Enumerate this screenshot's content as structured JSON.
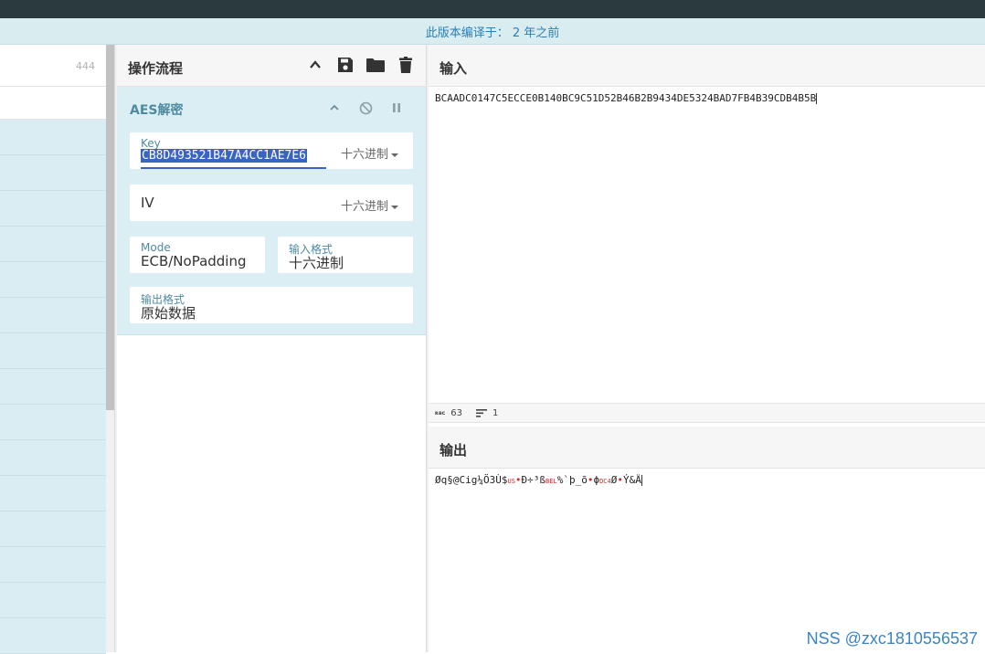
{
  "banner": {
    "text": "此版本编译于：  2 年之前"
  },
  "operations": {
    "count": "444"
  },
  "recipe": {
    "title": "操作流程",
    "icons": [
      "chevron-up-icon",
      "save-icon",
      "folder-icon",
      "trash-icon"
    ],
    "operation": {
      "name": "AES解密",
      "key": {
        "label": "Key",
        "value": "CB8D493521B47A4CC1AE7E6",
        "format": "十六进制"
      },
      "iv": {
        "label": "IV",
        "value": "",
        "format": "十六进制"
      },
      "mode": {
        "label": "Mode",
        "value": "ECB/NoPadding"
      },
      "input_format": {
        "label": "输入格式",
        "value": "十六进制"
      },
      "output_format": {
        "label": "输出格式",
        "value": "原始数据"
      }
    }
  },
  "input": {
    "title": "输入",
    "value": "BCAADC0147C5ECCE0B140BC9C51D52B46B2B9434DE5324BAD7FB4B39CDB4B5B",
    "length_label": "ʀʙᴄ",
    "length": "63",
    "lines": "1"
  },
  "output": {
    "title": "输出",
    "parts": [
      {
        "t": "Øq§@Cig¼Ö3Ù$",
        "c": "normal"
      },
      {
        "t": "US",
        "c": "ctrl"
      },
      {
        "t": "•",
        "c": "red"
      },
      {
        "t": "Ð÷³ß",
        "c": "normal"
      },
      {
        "t": "BEL",
        "c": "ctrl"
      },
      {
        "t": "%`þ_õ",
        "c": "normal"
      },
      {
        "t": "•",
        "c": "red"
      },
      {
        "t": "ϕ",
        "c": "normal"
      },
      {
        "t": "DC4",
        "c": "ctrl"
      },
      {
        "t": "Ø",
        "c": "normal"
      },
      {
        "t": "•",
        "c": "red"
      },
      {
        "t": "Ý&Ä",
        "c": "normal"
      }
    ]
  },
  "watermark": "NSS @zxc1810556537"
}
